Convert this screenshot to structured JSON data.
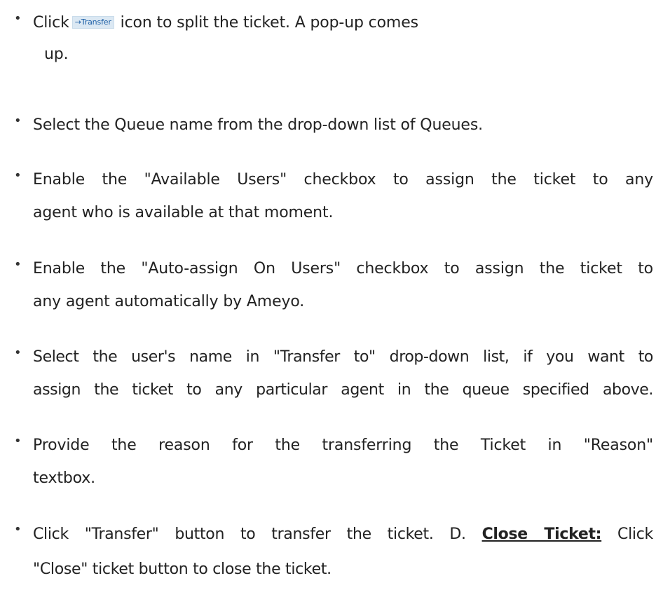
{
  "bullet_char": "•",
  "items": [
    {
      "before_icon": "Click",
      "icon": {
        "name": "transfer-icon",
        "label": "→Transfer"
      },
      "after_icon": "icon to split the ticket. A pop-up comes",
      "continuation": "up."
    },
    {
      "text": "Select the Queue name from the drop-down list of Queues."
    },
    {
      "line1": "Enable the \"Available Users\" checkbox to assign the ticket to any",
      "line2": "agent who is available at that moment."
    },
    {
      "line1": "Enable the \"Auto-assign On Users\" checkbox to assign the ticket to",
      "line2": "any agent automatically by Ameyo."
    },
    {
      "line1": "Select the user's name in \"Transfer to\" drop-down list, if you want to",
      "line2": "assign the ticket to any particular agent in the queue specified above."
    },
    {
      "line1": "Provide the reason for the transferring the Ticket in \"Reason\"",
      "line2": "textbox."
    },
    {
      "line1_before": "Click \"Transfer\" button to transfer the ticket.  D.",
      "bold_heading": "Close Ticket:",
      "line1_after": "Click",
      "line2": "\"Close\" ticket button to close the ticket."
    }
  ]
}
